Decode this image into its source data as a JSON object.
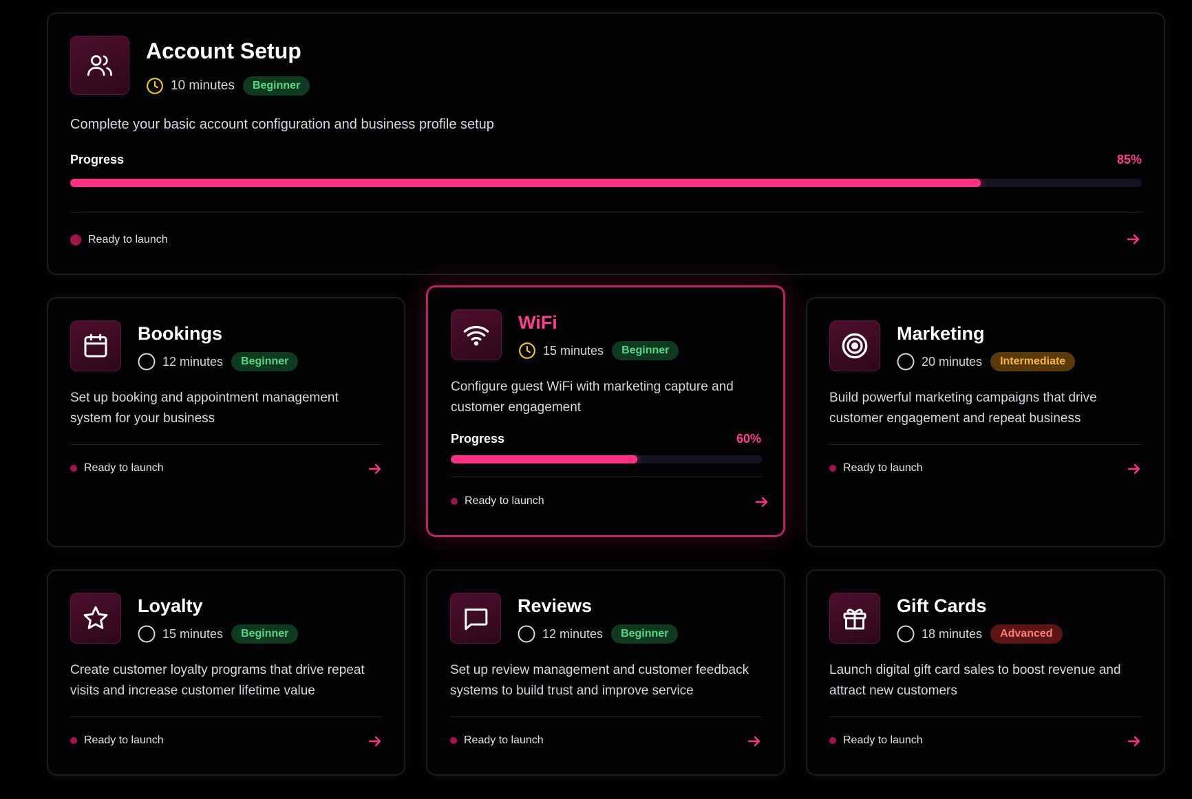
{
  "modules": [
    {
      "title": "Account Setup",
      "time": "10 minutes",
      "level": "Beginner",
      "description": "Complete your basic account configuration and business profile setup",
      "progress_label": "Progress",
      "progress_text": "85%",
      "progress": 0.85,
      "status": "Ready to launch",
      "icon": "users-icon"
    },
    {
      "title": "Bookings",
      "time": "12 minutes",
      "level": "Beginner",
      "description": "Set up booking and appointment management system for your business",
      "status": "Ready to launch",
      "icon": "calendar-icon"
    },
    {
      "title": "WiFi",
      "time": "15 minutes",
      "level": "Beginner",
      "description": "Configure guest WiFi with marketing capture and customer engagement",
      "progress_label": "Progress",
      "progress_text": "60%",
      "progress": 0.6,
      "status": "Ready to launch",
      "icon": "wifi-icon"
    },
    {
      "title": "Marketing",
      "time": "20 minutes",
      "level": "Intermediate",
      "description": "Build powerful marketing campaigns that drive customer engagement and repeat business",
      "status": "Ready to launch",
      "icon": "target-icon"
    },
    {
      "title": "Loyalty",
      "time": "15 minutes",
      "level": "Beginner",
      "description": "Create customer loyalty programs that drive repeat visits and increase customer lifetime value",
      "status": "Ready to launch",
      "icon": "star-icon"
    },
    {
      "title": "Reviews",
      "time": "12 minutes",
      "level": "Beginner",
      "description": "Set up review management and customer feedback systems to build trust and improve service",
      "status": "Ready to launch",
      "icon": "message-icon"
    },
    {
      "title": "Gift Cards",
      "time": "18 minutes",
      "level": "Advanced",
      "description": "Launch digital gift card sales to boost revenue and attract new customers",
      "status": "Ready to launch",
      "icon": "gift-icon"
    }
  ],
  "colors": {
    "accent": "#ff2f86",
    "beginner": "#56d68a",
    "intermediate": "#f5b640",
    "advanced": "#ff7b7b",
    "clock": "#f5c518"
  }
}
